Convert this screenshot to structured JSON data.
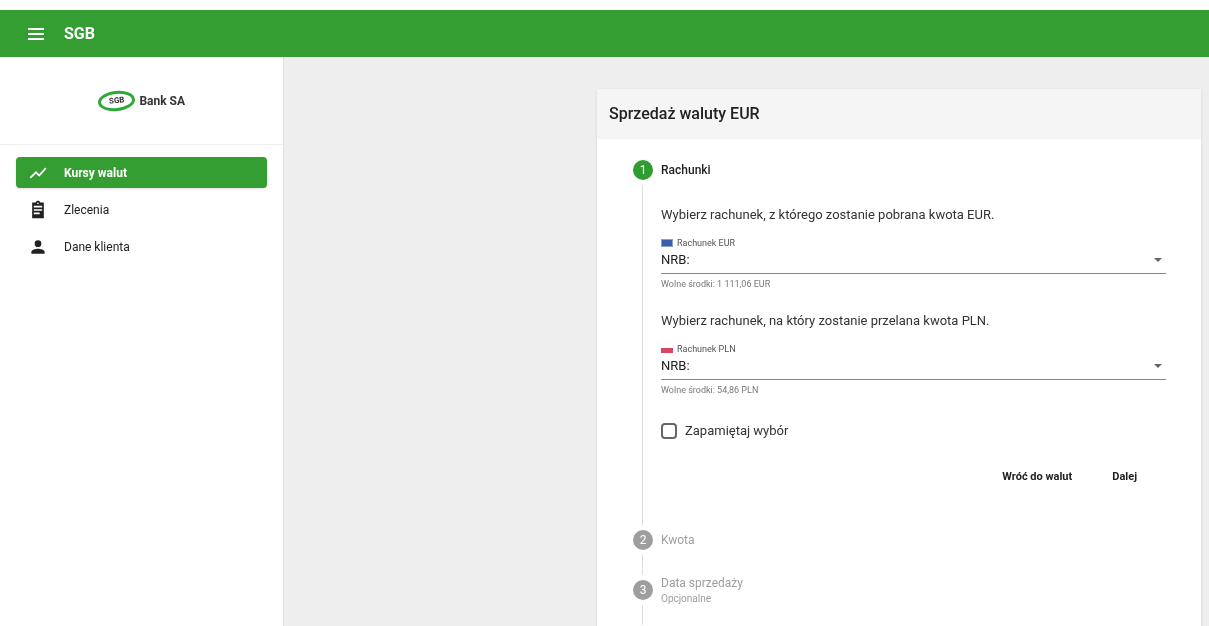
{
  "app_bar": {
    "title": "SGB"
  },
  "sidebar": {
    "logo": {
      "mark": "SGB",
      "text": "Bank SA"
    },
    "items": [
      {
        "label": "Kursy walut",
        "selected": true
      },
      {
        "label": "Zlecenia",
        "selected": false
      },
      {
        "label": "Dane klienta",
        "selected": false
      }
    ]
  },
  "card": {
    "title": "Sprzedaż waluty EUR",
    "steps": [
      {
        "number": "1",
        "label": "Rachunki",
        "active": true,
        "accounts": [
          {
            "prompt": "Wybierz rachunek, z którego zostanie pobrana kwota EUR.",
            "label": "Rachunek EUR",
            "value": "NRB:",
            "hint": "Wolne środki: 1 111,06 EUR"
          },
          {
            "prompt": "Wybierz rachunek, na który zostanie przelana kwota PLN.",
            "label": "Rachunek PLN",
            "value": "NRB:",
            "hint": "Wolne środki: 54,86 PLN"
          }
        ],
        "remember": {
          "label": "Zapamiętaj wybór",
          "checked": false
        },
        "buttons": [
          "Wróć do walut",
          "Dalej"
        ]
      },
      {
        "number": "2",
        "label": "Kwota",
        "active": false
      },
      {
        "number": "3",
        "label": "Data sprzedaży",
        "sublabel": "Opcjonalne",
        "active": false
      }
    ]
  }
}
